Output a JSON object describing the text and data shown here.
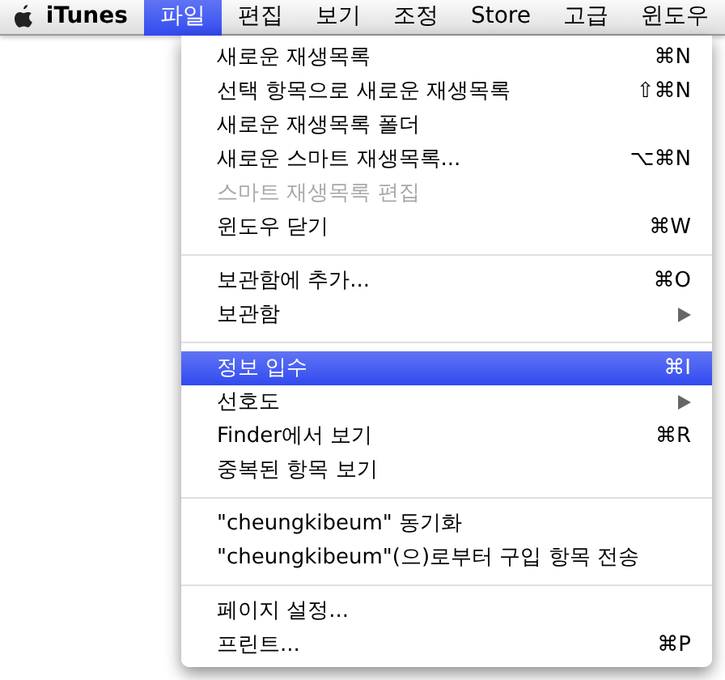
{
  "menu_bar": {
    "app_name": "iTunes",
    "menus": [
      {
        "label": "파일",
        "selected": true
      },
      {
        "label": "편집",
        "selected": false
      },
      {
        "label": "보기",
        "selected": false
      },
      {
        "label": "조정",
        "selected": false
      },
      {
        "label": "Store",
        "selected": false
      },
      {
        "label": "고급",
        "selected": false
      },
      {
        "label": "윈도우",
        "selected": false
      }
    ]
  },
  "file_menu": {
    "groups": [
      [
        {
          "label": "새로운 재생목록",
          "shortcut": "⌘N",
          "disabled": false,
          "selected": false,
          "submenu": false
        },
        {
          "label": "선택 항목으로 새로운 재생목록",
          "shortcut": "⇧⌘N",
          "disabled": false,
          "selected": false,
          "submenu": false
        },
        {
          "label": "새로운 재생목록 폴더",
          "disabled": false,
          "selected": false,
          "submenu": false
        },
        {
          "label": "새로운 스마트 재생목록...",
          "shortcut": "⌥⌘N",
          "disabled": false,
          "selected": false,
          "submenu": false
        },
        {
          "label": "스마트 재생목록 편집",
          "disabled": true,
          "selected": false,
          "submenu": false
        },
        {
          "label": "윈도우 닫기",
          "shortcut": "⌘W",
          "disabled": false,
          "selected": false,
          "submenu": false
        }
      ],
      [
        {
          "label": "보관함에 추가...",
          "shortcut": "⌘O",
          "disabled": false,
          "selected": false,
          "submenu": false
        },
        {
          "label": "보관함",
          "disabled": false,
          "selected": false,
          "submenu": true
        }
      ],
      [
        {
          "label": "정보 입수",
          "shortcut": "⌘I",
          "disabled": false,
          "selected": true,
          "submenu": false
        },
        {
          "label": "선호도",
          "disabled": false,
          "selected": false,
          "submenu": true
        },
        {
          "label": "Finder에서 보기",
          "shortcut": "⌘R",
          "disabled": false,
          "selected": false,
          "submenu": false
        },
        {
          "label": "중복된 항목 보기",
          "disabled": false,
          "selected": false,
          "submenu": false
        }
      ],
      [
        {
          "label": "\"cheungkibeum\" 동기화",
          "disabled": false,
          "selected": false,
          "submenu": false
        },
        {
          "label": "\"cheungkibeum\"(으)로부터 구입 항목 전송",
          "disabled": false,
          "selected": false,
          "submenu": false
        }
      ],
      [
        {
          "label": "페이지 설정...",
          "disabled": false,
          "selected": false,
          "submenu": false
        },
        {
          "label": "프린트...",
          "shortcut": "⌘P",
          "disabled": false,
          "selected": false,
          "submenu": false
        }
      ]
    ]
  }
}
